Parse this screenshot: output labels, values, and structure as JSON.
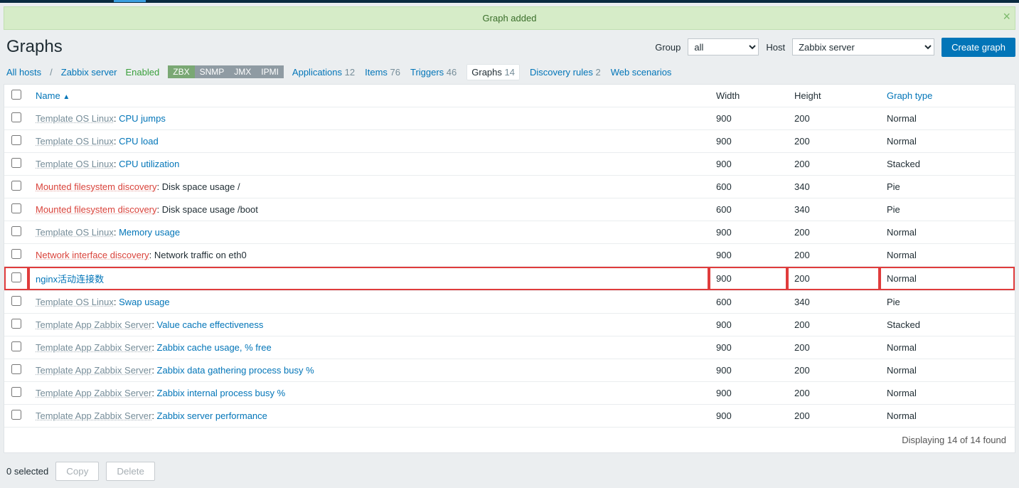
{
  "message": "Graph added",
  "page_title": "Graphs",
  "filters": {
    "group_label": "Group",
    "group_value": "all",
    "host_label": "Host",
    "host_value": "Zabbix server",
    "create_btn": "Create graph"
  },
  "breadcrumb": {
    "all_hosts": "All hosts",
    "host": "Zabbix server",
    "enabled": "Enabled",
    "tags": [
      "ZBX",
      "SNMP",
      "JMX",
      "IPMI"
    ],
    "items": [
      {
        "label": "Applications",
        "count": "12"
      },
      {
        "label": "Items",
        "count": "76"
      },
      {
        "label": "Triggers",
        "count": "46"
      },
      {
        "label": "Graphs",
        "count": "14",
        "active": true
      },
      {
        "label": "Discovery rules",
        "count": "2"
      },
      {
        "label": "Web scenarios",
        "count": ""
      }
    ]
  },
  "columns": {
    "name": "Name",
    "width": "Width",
    "height": "Height",
    "type": "Graph type"
  },
  "rows": [
    {
      "tpl": "Template OS Linux",
      "tpl_style": "grey",
      "name": "CPU jumps",
      "name_style": "blue",
      "w": "900",
      "h": "200",
      "t": "Normal"
    },
    {
      "tpl": "Template OS Linux",
      "tpl_style": "grey",
      "name": "CPU load",
      "name_style": "blue",
      "w": "900",
      "h": "200",
      "t": "Normal"
    },
    {
      "tpl": "Template OS Linux",
      "tpl_style": "grey",
      "name": "CPU utilization",
      "name_style": "blue",
      "w": "900",
      "h": "200",
      "t": "Stacked"
    },
    {
      "tpl": "Mounted filesystem discovery",
      "tpl_style": "red",
      "name": "Disk space usage /",
      "name_style": "plain",
      "w": "600",
      "h": "340",
      "t": "Pie"
    },
    {
      "tpl": "Mounted filesystem discovery",
      "tpl_style": "red",
      "name": "Disk space usage /boot",
      "name_style": "plain",
      "w": "600",
      "h": "340",
      "t": "Pie"
    },
    {
      "tpl": "Template OS Linux",
      "tpl_style": "grey",
      "name": "Memory usage",
      "name_style": "blue",
      "w": "900",
      "h": "200",
      "t": "Normal"
    },
    {
      "tpl": "Network interface discovery",
      "tpl_style": "red",
      "name": "Network traffic on eth0",
      "name_style": "plain",
      "w": "900",
      "h": "200",
      "t": "Normal"
    },
    {
      "tpl": "",
      "tpl_style": "",
      "name": "nginx活动连接数",
      "name_style": "blue",
      "w": "900",
      "h": "200",
      "t": "Normal",
      "highlight": true
    },
    {
      "tpl": "Template OS Linux",
      "tpl_style": "grey",
      "name": "Swap usage",
      "name_style": "blue",
      "w": "600",
      "h": "340",
      "t": "Pie"
    },
    {
      "tpl": "Template App Zabbix Server",
      "tpl_style": "grey",
      "name": "Value cache effectiveness",
      "name_style": "blue",
      "w": "900",
      "h": "200",
      "t": "Stacked"
    },
    {
      "tpl": "Template App Zabbix Server",
      "tpl_style": "grey",
      "name": "Zabbix cache usage, % free",
      "name_style": "blue",
      "w": "900",
      "h": "200",
      "t": "Normal"
    },
    {
      "tpl": "Template App Zabbix Server",
      "tpl_style": "grey",
      "name": "Zabbix data gathering process busy %",
      "name_style": "blue",
      "w": "900",
      "h": "200",
      "t": "Normal"
    },
    {
      "tpl": "Template App Zabbix Server",
      "tpl_style": "grey",
      "name": "Zabbix internal process busy %",
      "name_style": "blue",
      "w": "900",
      "h": "200",
      "t": "Normal"
    },
    {
      "tpl": "Template App Zabbix Server",
      "tpl_style": "grey",
      "name": "Zabbix server performance",
      "name_style": "blue",
      "w": "900",
      "h": "200",
      "t": "Normal"
    }
  ],
  "displaying": "Displaying 14 of 14 found",
  "selected": "0 selected",
  "actions": {
    "copy": "Copy",
    "delete": "Delete"
  }
}
